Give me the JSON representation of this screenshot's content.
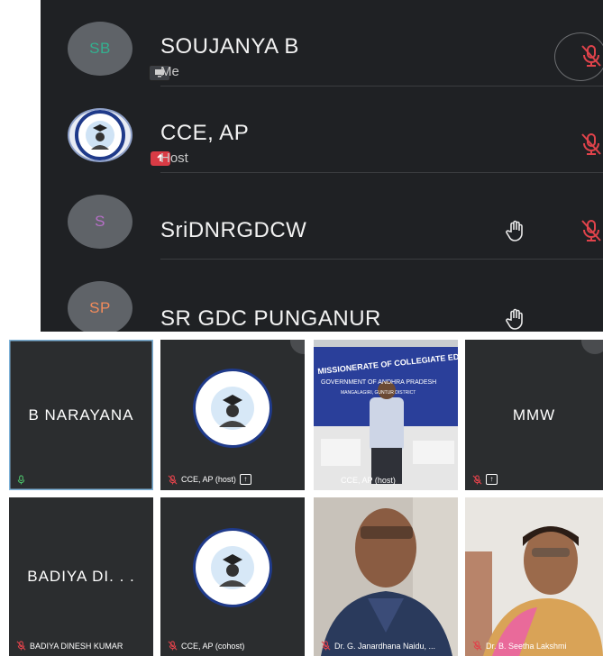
{
  "participants": [
    {
      "initials": "SB",
      "name": "SOUJANYA B",
      "role": "Me",
      "avatar_color": "#33b08f",
      "badge": "screen-icon",
      "muted": true
    },
    {
      "initials": "",
      "name": "CCE,  AP",
      "role": "Host",
      "avatar_color": "",
      "badge": "share-up-icon",
      "muted": true
    },
    {
      "initials": "S",
      "name": "SriDNRGDCW",
      "role": "",
      "avatar_color": "#b66fc7",
      "raised_hand": true,
      "muted": true
    },
    {
      "initials": "SP",
      "name": "SR GDC PUNGANUR",
      "role": "",
      "avatar_color": "#f28b5b",
      "raised_hand": true
    }
  ],
  "tiles": [
    {
      "title": "B NARAYANA",
      "caption": "",
      "mic": "on"
    },
    {
      "title": "",
      "caption": "CCE,  AP (host)",
      "mic": "muted",
      "share": true
    },
    {
      "title": "",
      "caption": "CCE, AP (host)",
      "mic": "none",
      "video": true,
      "banner_line1": "MISSIONERATE OF COLLEGIATE EDUCA",
      "banner_line2": "GOVERNMENT OF ANDHRA PRADESH",
      "banner_line3": "MANGALAGIRI, GUNTUR DISTRICT"
    },
    {
      "title": "MMW",
      "caption": "",
      "mic": "muted",
      "share": true
    },
    {
      "title": "BADIYA DI. . .",
      "caption": "BADIYA DINESH KUMAR",
      "mic": "muted"
    },
    {
      "title": "",
      "caption": "CCE, AP (cohost)",
      "mic": "muted"
    },
    {
      "title": "",
      "caption": "Dr. G. Janardhana Naidu, ...",
      "mic": "muted",
      "video": true
    },
    {
      "title": "",
      "caption": "Dr. B. Seetha Lakshmi",
      "mic": "muted",
      "video": true
    }
  ],
  "colors": {
    "mute_red": "#e0434b",
    "panel_bg": "#1f2124",
    "tile_bg": "#2b2d2f"
  }
}
